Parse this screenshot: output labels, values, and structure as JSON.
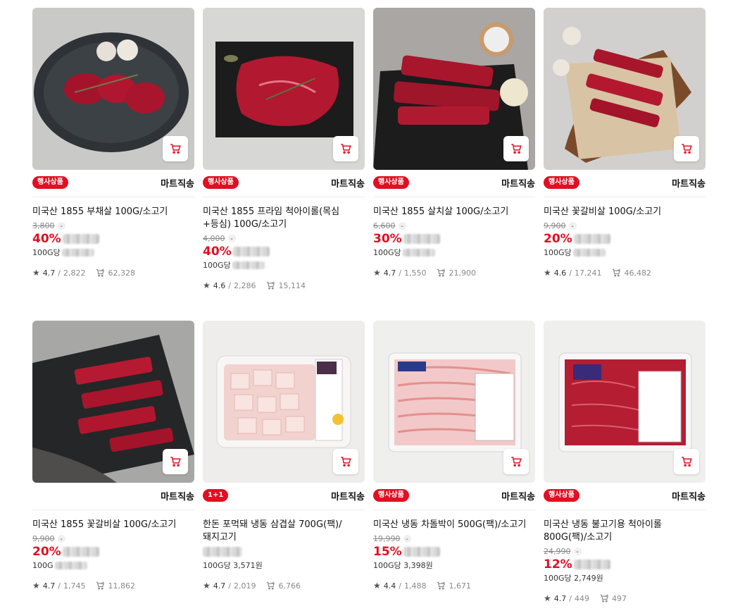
{
  "products": [
    {
      "image": "steak-pan",
      "badge": "행사상품",
      "badge_color": "#e10f22",
      "shipping": "마트직송",
      "title": "미국산 1855 부채살 100G/소고기",
      "orig_price": "3,800",
      "discount": "40%",
      "unit": "100G당",
      "rating": "4.7",
      "reviews": "2,822",
      "carts": "62,328"
    },
    {
      "image": "steak-board",
      "badge": "행사상품",
      "badge_color": "#e10f22",
      "shipping": "마트직송",
      "title": "미국산 1855 프라임 척아이롤(목심+등심) 100G/소고기",
      "orig_price": "4,000",
      "discount": "40%",
      "unit": "100G당",
      "rating": "4.6",
      "reviews": "2,286",
      "carts": "15,114"
    },
    {
      "image": "strips-slate",
      "badge": "행사상품",
      "badge_color": "#e10f22",
      "shipping": "마트직송",
      "title": "미국산 1855 살치살 100G/소고기",
      "orig_price": "6,600",
      "discount": "30%",
      "unit": "100G당",
      "rating": "4.7",
      "reviews": "1,550",
      "carts": "21,900"
    },
    {
      "image": "strips-paper",
      "badge": "행사상품",
      "badge_color": "#e10f22",
      "shipping": "마트직송",
      "title": "미국산 꽃갈비살 100G/소고기",
      "orig_price": "9,900",
      "discount": "20%",
      "unit": "100G당",
      "rating": "4.6",
      "reviews": "17,241",
      "carts": "46,482"
    },
    {
      "image": "ribs-slate",
      "badge": "",
      "badge_color": "#e10f22",
      "shipping": "마트직송",
      "title": "미국산 1855 꽃갈비살 100G/소고기",
      "orig_price": "9,900",
      "discount": "20%",
      "unit": "100G",
      "rating": "4.7",
      "reviews": "1,745",
      "carts": "11,862"
    },
    {
      "image": "pork-pack",
      "badge": "1+1",
      "badge_color": "#e10f22",
      "shipping": "마트직송",
      "title": "한돈 포먹돼 냉동 삼겹살 700G(팩)/돼지고기",
      "orig_price": "",
      "discount": "",
      "unit": "100G당 3,571원",
      "rating": "4.7",
      "reviews": "2,019",
      "carts": "6,766"
    },
    {
      "image": "brisket-pack",
      "badge": "행사상품",
      "badge_color": "#e10f22",
      "shipping": "마트직송",
      "title": "미국산 냉동 차돌박이 500G(팩)/소고기",
      "orig_price": "19,990",
      "discount": "15%",
      "unit": "100G당 3,398원",
      "rating": "4.4",
      "reviews": "1,488",
      "carts": "1,671"
    },
    {
      "image": "bulgogi-pack",
      "badge": "행사상품",
      "badge_color": "#e10f22",
      "shipping": "마트직송",
      "title": "미국산 냉동 불고기용 척아이롤 800G(팩)/소고기",
      "orig_price": "24,990",
      "discount": "12%",
      "unit": "100G당 2,749원",
      "rating": "4.7",
      "reviews": "449",
      "carts": "497"
    }
  ],
  "colors": {
    "accent": "#e10f22",
    "muted": "#888888"
  },
  "icons": {
    "cart": "cart-icon",
    "star": "star-icon",
    "cart_count": "cart-count-icon",
    "chevron": "chevron-down-icon"
  }
}
